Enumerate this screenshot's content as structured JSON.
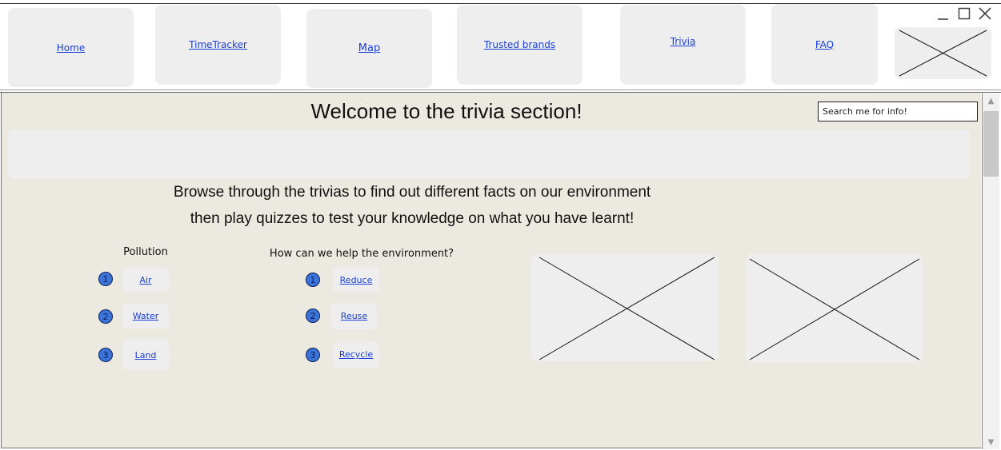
{
  "nav": {
    "home": "Home",
    "timetracker": "TimeTracker",
    "map": "Map",
    "trusted": "Trusted brands",
    "trivia": "Trivia",
    "faq": "FAQ"
  },
  "window": {
    "minimize_icon": "minimize-icon",
    "maximize_icon": "maximize-icon",
    "close_icon": "close-icon"
  },
  "page": {
    "title": "Welcome to the trivia section!",
    "search_placeholder": "Search me for info!",
    "intro_line1": "Browse through the trivias to find out different facts on our environment",
    "intro_line2": "then play quizzes to test your knowledge on what you have learnt!"
  },
  "pollution": {
    "title": "Pollution",
    "items": [
      {
        "num": "1",
        "label": "Air"
      },
      {
        "num": "2",
        "label": "Water"
      },
      {
        "num": "3",
        "label": "Land"
      }
    ]
  },
  "help": {
    "title": "How can we help the environment?",
    "items": [
      {
        "num": "1",
        "label": "Reduce"
      },
      {
        "num": "2",
        "label": "Reuse"
      },
      {
        "num": "3",
        "label": "Recycle"
      }
    ]
  },
  "colors": {
    "link": "#1a3fd6",
    "badge": "#3b73d9",
    "content_bg": "#ece9e1",
    "placeholder_bg": "#eeeeee"
  }
}
